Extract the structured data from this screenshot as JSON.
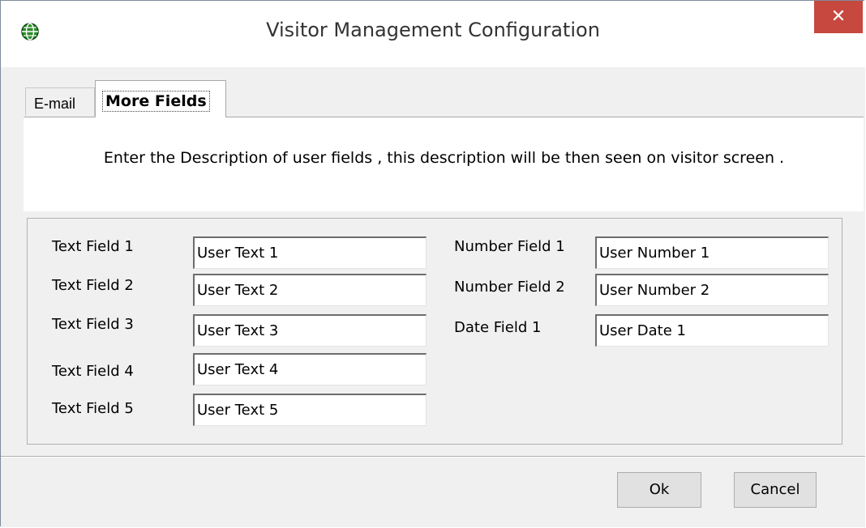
{
  "window": {
    "title": "Visitor Management Configuration",
    "icon": "globe-app-icon",
    "close_glyph": "✕"
  },
  "tabs": [
    {
      "label": "E-mail",
      "active": false
    },
    {
      "label": "More Fields",
      "active": true
    }
  ],
  "description": "Enter the Description of user fields , this description will be then seen on visitor screen .",
  "text_fields": [
    {
      "label": "Text Field 1",
      "value": "User Text 1"
    },
    {
      "label": "Text Field 2",
      "value": "User Text 2"
    },
    {
      "label": "Text Field 3",
      "value": "User Text 3"
    },
    {
      "label": "Text Field 4",
      "value": "User Text 4"
    },
    {
      "label": "Text Field 5",
      "value": "User Text 5"
    }
  ],
  "other_fields": [
    {
      "label": "Number Field 1",
      "value": "User Number 1"
    },
    {
      "label": "Number Field 2",
      "value": "User Number 2"
    },
    {
      "label": "Date Field 1",
      "value": "User Date 1"
    }
  ],
  "buttons": {
    "ok": "Ok",
    "cancel": "Cancel"
  },
  "colors": {
    "close_button": "#c7483f",
    "window_background": "#f0f0f0"
  }
}
